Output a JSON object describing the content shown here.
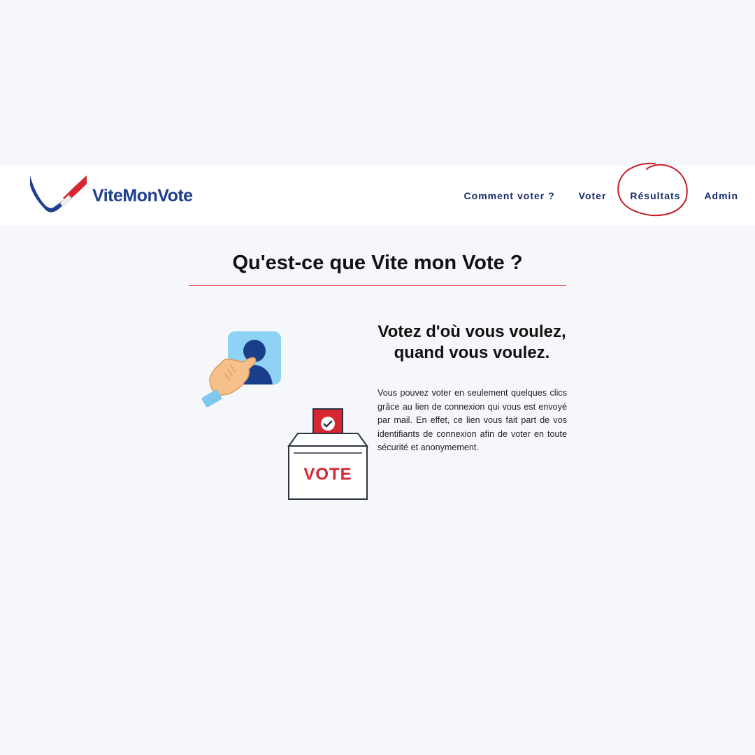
{
  "header": {
    "logo_text": "ViteMonVote",
    "nav": [
      {
        "label": "Comment voter ?"
      },
      {
        "label": "Voter"
      },
      {
        "label": "Résultats"
      },
      {
        "label": "Admin"
      }
    ]
  },
  "main": {
    "title": "Qu'est-ce que Vite mon Vote ?",
    "feature": {
      "heading": "Votez d'où vous voulez, quand vous voulez.",
      "body": "Vous pouvez voter en seulement quelques clics grâce au lien de connexion qui vous est envoyé par mail. En effet, ce lien vous fait part de vos identifiants de connexion afin de voter en toute sécurité et anonymement.",
      "ballot_label": "VOTE"
    }
  },
  "colors": {
    "brand_blue": "#1f3f8f",
    "brand_red": "#d62631",
    "nav_text": "#16296b",
    "annotation_circle": "#c41e2a"
  },
  "icons": [
    "logo-checkmark-icon",
    "hand-touch-profile-icon",
    "ballot-box-icon",
    "check-icon"
  ]
}
